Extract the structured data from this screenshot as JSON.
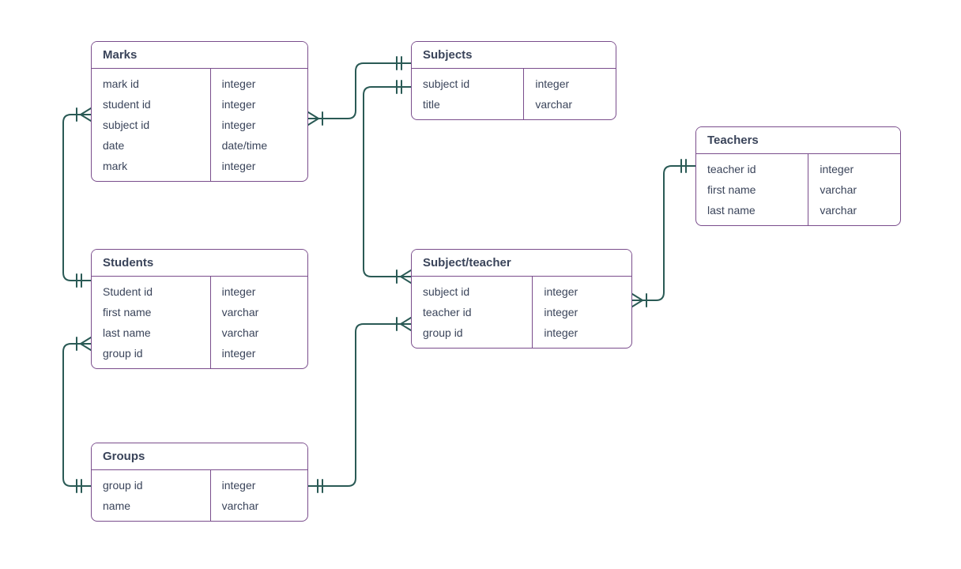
{
  "diagram_type": "entity-relationship",
  "colors": {
    "entity_border": "#7a4d8c",
    "connector": "#2a5a55",
    "text": "#3a445a"
  },
  "entities": {
    "marks": {
      "title": "Marks",
      "fields": [
        {
          "name": "mark id",
          "type": "integer"
        },
        {
          "name": "student id",
          "type": "integer"
        },
        {
          "name": "subject id",
          "type": "integer"
        },
        {
          "name": "date",
          "type": "date/time"
        },
        {
          "name": "mark",
          "type": "integer"
        }
      ]
    },
    "subjects": {
      "title": "Subjects",
      "fields": [
        {
          "name": "subject id",
          "type": "integer"
        },
        {
          "name": "title",
          "type": "varchar"
        }
      ]
    },
    "teachers": {
      "title": "Teachers",
      "fields": [
        {
          "name": "teacher id",
          "type": "integer"
        },
        {
          "name": "first name",
          "type": "varchar"
        },
        {
          "name": "last name",
          "type": "varchar"
        }
      ]
    },
    "students": {
      "title": "Students",
      "fields": [
        {
          "name": "Student id",
          "type": "integer"
        },
        {
          "name": "first name",
          "type": "varchar"
        },
        {
          "name": "last name",
          "type": "varchar"
        },
        {
          "name": "group id",
          "type": "integer"
        }
      ]
    },
    "subject_teacher": {
      "title": "Subject/teacher",
      "fields": [
        {
          "name": "subject id",
          "type": "integer"
        },
        {
          "name": "teacher id",
          "type": "integer"
        },
        {
          "name": "group id",
          "type": "integer"
        }
      ]
    },
    "groups": {
      "title": "Groups",
      "fields": [
        {
          "name": "group id",
          "type": "integer"
        },
        {
          "name": "name",
          "type": "varchar"
        }
      ]
    }
  },
  "relationships": [
    {
      "from": "marks",
      "to": "students",
      "from_card": "many",
      "to_card": "one"
    },
    {
      "from": "marks",
      "to": "subjects",
      "from_card": "many",
      "to_card": "one"
    },
    {
      "from": "students",
      "to": "groups",
      "from_card": "many",
      "to_card": "one"
    },
    {
      "from": "subject_teacher",
      "to": "subjects",
      "from_card": "many",
      "to_card": "one"
    },
    {
      "from": "subject_teacher",
      "to": "teachers",
      "from_card": "many",
      "to_card": "one"
    },
    {
      "from": "subject_teacher",
      "to": "groups",
      "from_card": "many",
      "to_card": "one"
    }
  ]
}
